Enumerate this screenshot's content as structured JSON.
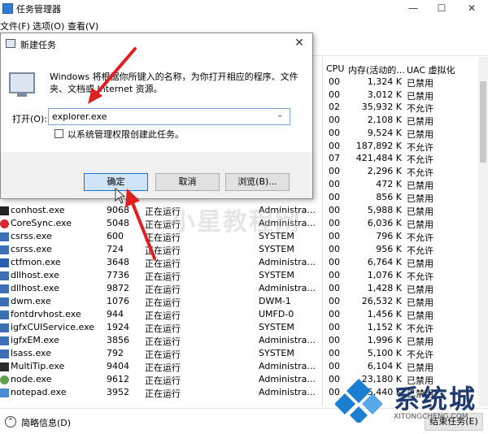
{
  "window": {
    "title": "任务管理器",
    "menu": [
      "文件(F)",
      "选项(O)",
      "查看(V)"
    ],
    "controls": {
      "minimize": "—",
      "maximize": "☐",
      "close": "✕"
    }
  },
  "columns": {
    "cpu": "CPU",
    "memory": "内存(活动的...",
    "uac": "UAC 虚拟化"
  },
  "upper_rows": [
    {
      "cpu": "00",
      "mem": "1,324 K",
      "uac": "已禁用"
    },
    {
      "cpu": "00",
      "mem": "3,012 K",
      "uac": "已禁用"
    },
    {
      "cpu": "02",
      "mem": "35,932 K",
      "uac": "不允许"
    },
    {
      "cpu": "00",
      "mem": "2,108 K",
      "uac": "已禁用"
    },
    {
      "cpu": "00",
      "mem": "9,524 K",
      "uac": "已禁用"
    },
    {
      "cpu": "00",
      "mem": "187,892 K",
      "uac": "不允许"
    },
    {
      "cpu": "07",
      "mem": "421,484 K",
      "uac": "不允许"
    },
    {
      "cpu": "00",
      "mem": "2,296 K",
      "uac": "不允许"
    },
    {
      "cpu": "00",
      "mem": "472 K",
      "uac": "已禁用"
    },
    {
      "cpu": "00",
      "mem": "856 K",
      "uac": "已禁用"
    }
  ],
  "processes": [
    {
      "name": "conhost.exe",
      "pid": "9068",
      "status": "正在运行",
      "user": "Administra...",
      "cpu": "00",
      "mem": "5,988 K",
      "uac": "已禁用",
      "icon_color": "#222222"
    },
    {
      "name": "CoreSync.exe",
      "pid": "5048",
      "status": "正在运行",
      "user": "Administra...",
      "cpu": "00",
      "mem": "6,036 K",
      "uac": "已禁用",
      "icon_color": "#d9262b"
    },
    {
      "name": "csrss.exe",
      "pid": "600",
      "status": "正在运行",
      "user": "SYSTEM",
      "cpu": "00",
      "mem": "796 K",
      "uac": "不允许",
      "icon_color": "#3d6fb6"
    },
    {
      "name": "csrss.exe",
      "pid": "724",
      "status": "正在运行",
      "user": "SYSTEM",
      "cpu": "00",
      "mem": "956 K",
      "uac": "不允许",
      "icon_color": "#3d6fb6"
    },
    {
      "name": "ctfmon.exe",
      "pid": "3648",
      "status": "正在运行",
      "user": "Administra...",
      "cpu": "00",
      "mem": "6,764 K",
      "uac": "已禁用",
      "icon_color": "#2a5db0"
    },
    {
      "name": "dllhost.exe",
      "pid": "7736",
      "status": "正在运行",
      "user": "SYSTEM",
      "cpu": "00",
      "mem": "1,076 K",
      "uac": "不允许",
      "icon_color": "#3d6fb6"
    },
    {
      "name": "dllhost.exe",
      "pid": "9872",
      "status": "正在运行",
      "user": "Administra...",
      "cpu": "00",
      "mem": "1,428 K",
      "uac": "已禁用",
      "icon_color": "#3d6fb6"
    },
    {
      "name": "dwm.exe",
      "pid": "1076",
      "status": "正在运行",
      "user": "DWM-1",
      "cpu": "00",
      "mem": "26,532 K",
      "uac": "已禁用",
      "icon_color": "#3d6fb6"
    },
    {
      "name": "fontdrvhost.exe",
      "pid": "944",
      "status": "正在运行",
      "user": "UMFD-0",
      "cpu": "00",
      "mem": "1,456 K",
      "uac": "已禁用",
      "icon_color": "#3d6fb6"
    },
    {
      "name": "igfxCUIService.exe",
      "pid": "1924",
      "status": "正在运行",
      "user": "SYSTEM",
      "cpu": "00",
      "mem": "1,152 K",
      "uac": "不允许",
      "icon_color": "#3d6fb6"
    },
    {
      "name": "igfxEM.exe",
      "pid": "3856",
      "status": "正在运行",
      "user": "Administra...",
      "cpu": "00",
      "mem": "1,996 K",
      "uac": "已禁用",
      "icon_color": "#3d6fb6"
    },
    {
      "name": "lsass.exe",
      "pid": "792",
      "status": "正在运行",
      "user": "SYSTEM",
      "cpu": "00",
      "mem": "5,100 K",
      "uac": "不允许",
      "icon_color": "#3d6fb6"
    },
    {
      "name": "MultiTip.exe",
      "pid": "9404",
      "status": "正在运行",
      "user": "Administra...",
      "cpu": "00",
      "mem": "6,104 K",
      "uac": "已禁用",
      "icon_color": "#2a2a2a"
    },
    {
      "name": "node.exe",
      "pid": "9612",
      "status": "正在运行",
      "user": "Administra...",
      "cpu": "00",
      "mem": "23,180 K",
      "uac": "已禁用",
      "icon_color": "#5fa04e"
    },
    {
      "name": "notepad.exe",
      "pid": "3952",
      "status": "正在运行",
      "user": "Administra...",
      "cpu": "00",
      "mem": "5,440 K",
      "uac": "已禁用",
      "icon_color": "#4a8bd6"
    }
  ],
  "footer": {
    "fewer_details": "简略信息(D)",
    "end_task": "结束任务(E)"
  },
  "dialog": {
    "title": "新建任务",
    "description": "Windows 将根据你所键入的名称，为你打开相应的程序、文件夹、文档或 Internet 资源。",
    "open_label": "打开(O):",
    "open_value": "explorer.exe",
    "admin_label": "以系统管理权限创建此任务。",
    "ok": "确定",
    "cancel": "取消",
    "browse": "浏览(B)..."
  },
  "watermarks": {
    "center": "小星教程网",
    "brand": "系统城",
    "url": "XITONGCHENG.COM"
  },
  "colors": {
    "accent": "#0078d7",
    "arrow": "#e02020",
    "brand": "#1e3a6e",
    "logo": "#1a7fd0"
  }
}
